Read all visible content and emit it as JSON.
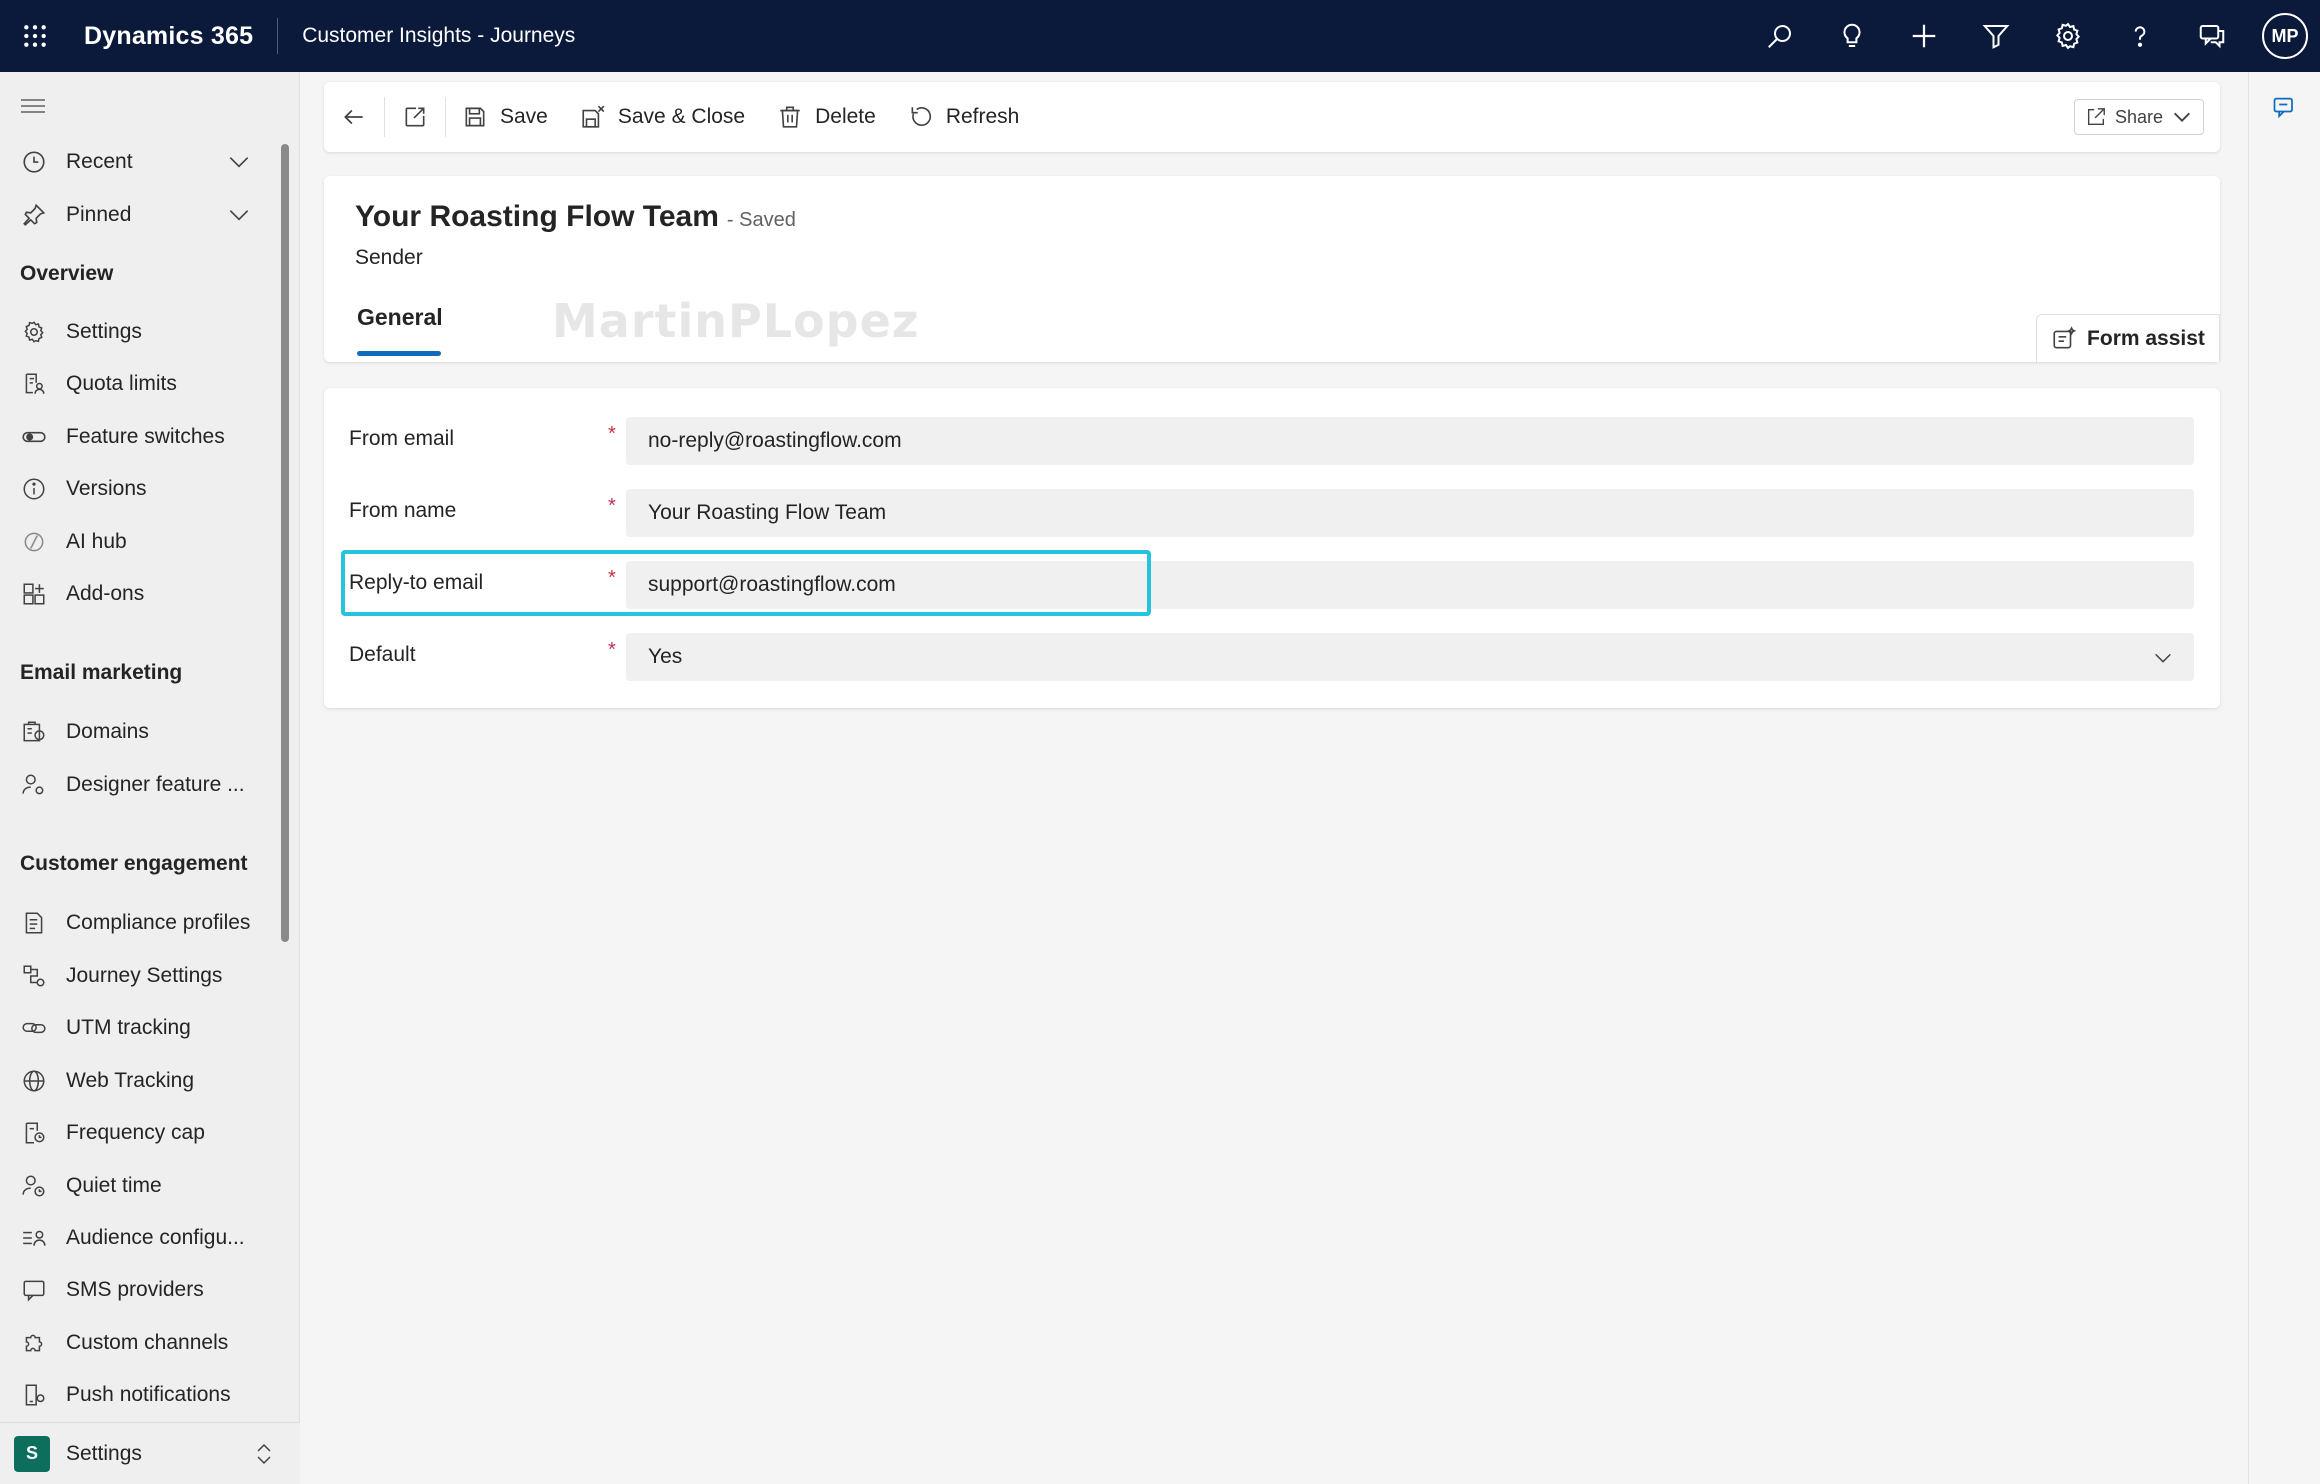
{
  "topbar": {
    "app_name": "Dynamics 365",
    "area_name": "Customer Insights - Journeys",
    "icons": [
      "search-icon",
      "lightbulb-icon",
      "plus-icon",
      "filter-icon",
      "gear-icon",
      "help-icon",
      "chat-icon"
    ],
    "avatar_initials": "MP"
  },
  "nav": {
    "recent": "Recent",
    "pinned": "Pinned",
    "sections": [
      {
        "heading": "Overview",
        "items": [
          "Settings",
          "Quota limits",
          "Feature switches",
          "Versions",
          "AI hub",
          "Add-ons"
        ]
      },
      {
        "heading": "Email marketing",
        "items": [
          "Domains",
          "Designer feature ..."
        ]
      },
      {
        "heading": "Customer engagement",
        "items": [
          "Compliance profiles",
          "Journey Settings",
          "UTM tracking",
          "Web Tracking",
          "Frequency cap",
          "Quiet time",
          "Audience configu...",
          "SMS providers",
          "Custom channels",
          "Push notifications"
        ]
      }
    ],
    "footer": {
      "badge": "S",
      "label": "Settings"
    }
  },
  "commandbar": {
    "save": "Save",
    "save_close": "Save & Close",
    "delete": "Delete",
    "refresh": "Refresh",
    "share": "Share"
  },
  "record": {
    "title": "Your Roasting Flow Team",
    "status": "- Saved",
    "entity": "Sender",
    "tab": "General",
    "watermark": "MartinPLopez",
    "form_assist": "Form assist"
  },
  "form": {
    "fields": [
      {
        "label": "From email",
        "required": "*",
        "value": "no-reply@roastingflow.com"
      },
      {
        "label": "From name",
        "required": "*",
        "value": "Your Roasting Flow Team"
      },
      {
        "label": "Reply-to email",
        "required": "*",
        "value": "support@roastingflow.com"
      },
      {
        "label": "Default",
        "required": "*",
        "value": "Yes"
      }
    ]
  },
  "colors": {
    "topbar": "#0b1a3a",
    "accent": "#0f6cbd",
    "highlight": "#25c4dc",
    "required": "#c4314b"
  }
}
